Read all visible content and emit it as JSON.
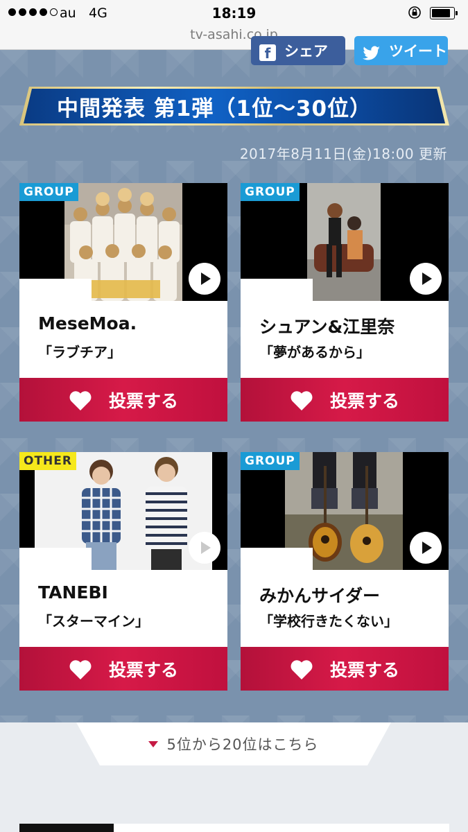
{
  "status_bar": {
    "carrier": "au",
    "network": "4G",
    "time": "18:19"
  },
  "url_bar": {
    "domain": "tv-asahi.co.jp"
  },
  "share": {
    "facebook_label": "シェア",
    "twitter_label": "ツイート"
  },
  "section": {
    "title": "中間発表 第1弾（1位〜30位）",
    "updated": "2017年8月11日(金)18:00 更新"
  },
  "cards": [
    {
      "category": "GROUP",
      "artist": "MeseMoa.",
      "song": "「ラブチア」",
      "vote_label": "投票する"
    },
    {
      "category": "GROUP",
      "artist": "シュアン&江里奈",
      "song": "「夢があるから」",
      "vote_label": "投票する"
    },
    {
      "category": "OTHER",
      "artist": "TANEBI",
      "song": "「スターマイン」",
      "vote_label": "投票する"
    },
    {
      "category": "GROUP",
      "artist": "みかんサイダー",
      "song": "「学校行きたくない」",
      "vote_label": "投票する"
    }
  ],
  "more_link": {
    "label": "5位から20位はこちら"
  },
  "colors": {
    "background": "#7a92ad",
    "vote_red": "#d61a48",
    "banner_blue": "#1061c4",
    "group_tag": "#1a9bd5",
    "other_tag": "#f6e81c"
  }
}
